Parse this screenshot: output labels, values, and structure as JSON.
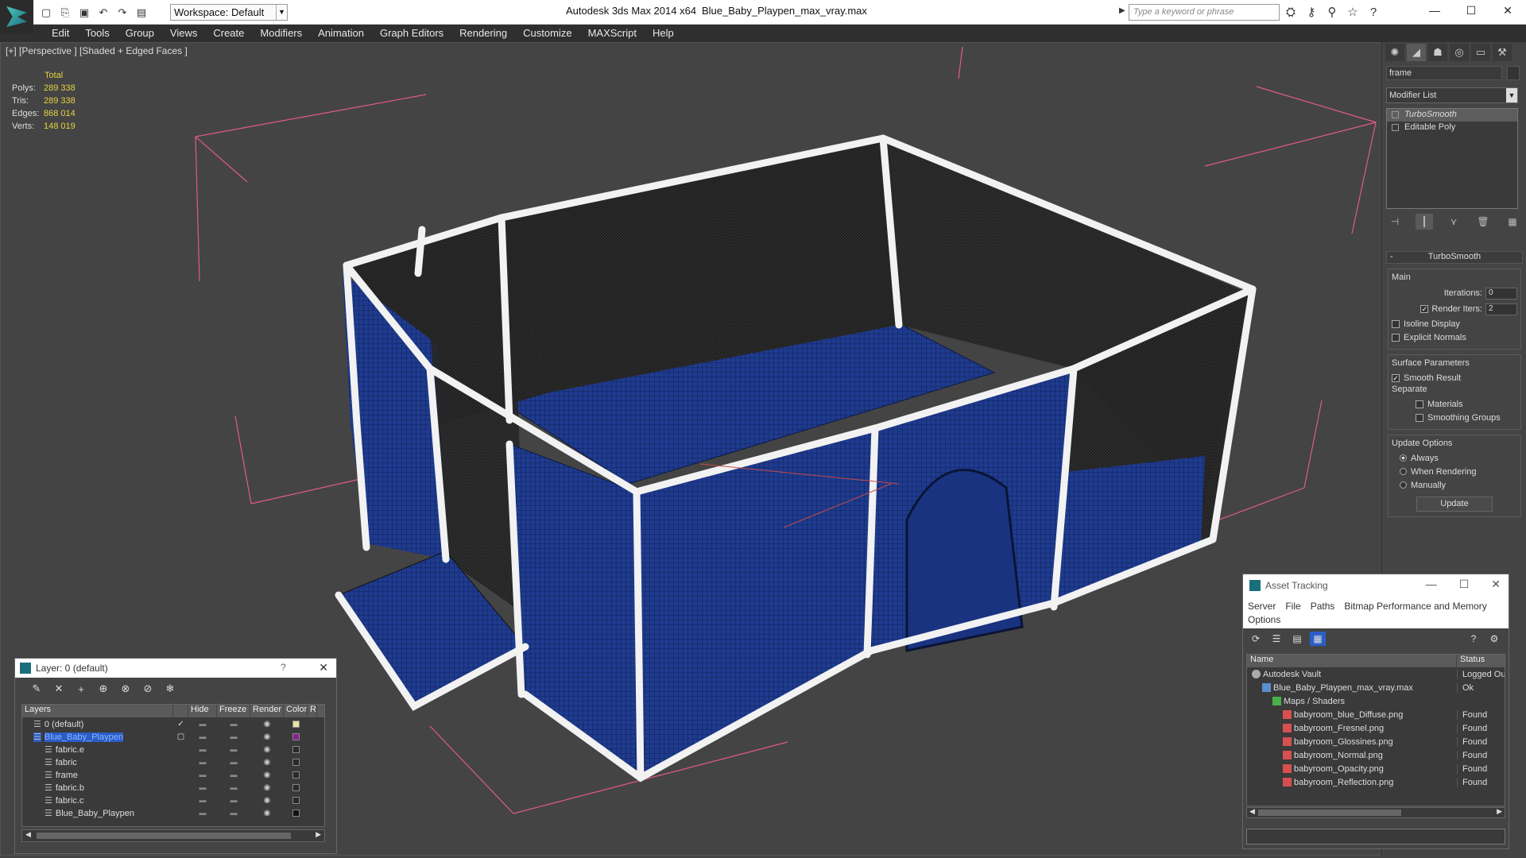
{
  "titlebar": {
    "workspace": "Workspace: Default",
    "app_title": "Autodesk 3ds Max  2014 x64",
    "file_title": "Blue_Baby_Playpen_max_vray.max",
    "search_placeholder": "Type a keyword or phrase"
  },
  "menu": [
    "Edit",
    "Tools",
    "Group",
    "Views",
    "Create",
    "Modifiers",
    "Animation",
    "Graph Editors",
    "Rendering",
    "Customize",
    "MAXScript",
    "Help"
  ],
  "viewport": {
    "label": "[+] [Perspective ] [Shaded + Edged Faces ]",
    "stats_header": "Total",
    "stats": [
      {
        "label": "Polys:",
        "value": "289 338"
      },
      {
        "label": "Tris:",
        "value": "289 338"
      },
      {
        "label": "Edges:",
        "value": "868 014"
      },
      {
        "label": "Verts:",
        "value": "148 019"
      }
    ]
  },
  "command_panel": {
    "object_name": "frame",
    "modifier_list": "Modifier List",
    "stack": [
      "TurboSmooth",
      "Editable Poly"
    ],
    "rollout_title": "TurboSmooth",
    "main_group": "Main",
    "iterations_label": "Iterations:",
    "iterations_value": "0",
    "render_iters_label": "Render Iters:",
    "render_iters_value": "2",
    "isoline_label": "Isoline Display",
    "explicit_label": "Explicit Normals",
    "surface_group": "Surface Parameters",
    "smooth_result_label": "Smooth Result",
    "separate_label": "Separate",
    "materials_label": "Materials",
    "smoothing_groups_label": "Smoothing Groups",
    "update_group": "Update Options",
    "always_label": "Always",
    "when_rendering_label": "When Rendering",
    "manually_label": "Manually",
    "update_button": "Update"
  },
  "layer_dialog": {
    "title": "Layer: 0 (default)",
    "help": "?",
    "columns": [
      "Layers",
      "Hide",
      "Freeze",
      "Render",
      "Color",
      "R"
    ],
    "rows": [
      {
        "name": "0 (default)",
        "indent": 1,
        "color": "#e6e6a0",
        "active": "✓"
      },
      {
        "name": "Blue_Baby_Playpen",
        "indent": 1,
        "color": "#8a2090",
        "active": "▢",
        "selected": true
      },
      {
        "name": "fabric.e",
        "indent": 2,
        "color": "#2a2a2a"
      },
      {
        "name": "fabric",
        "indent": 2,
        "color": "#2a2a2a"
      },
      {
        "name": "frame",
        "indent": 2,
        "color": "#2a2a2a"
      },
      {
        "name": "fabric.b",
        "indent": 2,
        "color": "#2a2a2a"
      },
      {
        "name": "fabric.c",
        "indent": 2,
        "color": "#2a2a2a"
      },
      {
        "name": "Blue_Baby_Playpen",
        "indent": 2,
        "color": "#111111"
      }
    ]
  },
  "asset_dialog": {
    "title": "Asset Tracking",
    "menu": [
      "Server",
      "File",
      "Paths",
      "Bitmap Performance and Memory",
      "Options"
    ],
    "columns": [
      "Name",
      "Status"
    ],
    "rows": [
      {
        "name": "Autodesk Vault",
        "status": "Logged Ou",
        "icon": "vault",
        "indent": 1
      },
      {
        "name": "Blue_Baby_Playpen_max_vray.max",
        "status": "Ok",
        "icon": "max",
        "indent": 2
      },
      {
        "name": "Maps / Shaders",
        "status": "",
        "icon": "maps",
        "indent": 3
      },
      {
        "name": "babyroom_blue_Diffuse.png",
        "status": "Found",
        "icon": "png",
        "indent": 4
      },
      {
        "name": "babyroom_Fresnel.png",
        "status": "Found",
        "icon": "png",
        "indent": 4
      },
      {
        "name": "babyroom_Glossines.png",
        "status": "Found",
        "icon": "png",
        "indent": 4
      },
      {
        "name": "babyroom_Normal.png",
        "status": "Found",
        "icon": "png",
        "indent": 4
      },
      {
        "name": "babyroom_Opacity.png",
        "status": "Found",
        "icon": "png",
        "indent": 4
      },
      {
        "name": "babyroom_Reflection.png",
        "status": "Found",
        "icon": "png",
        "indent": 4
      }
    ]
  },
  "colors": {
    "stats_value": "#e6d340",
    "selection": "#2a5dc7",
    "fabric": "#1e3a8c",
    "frame_white": "#f2f2f2",
    "bbox_pink": "#e05a8a"
  }
}
